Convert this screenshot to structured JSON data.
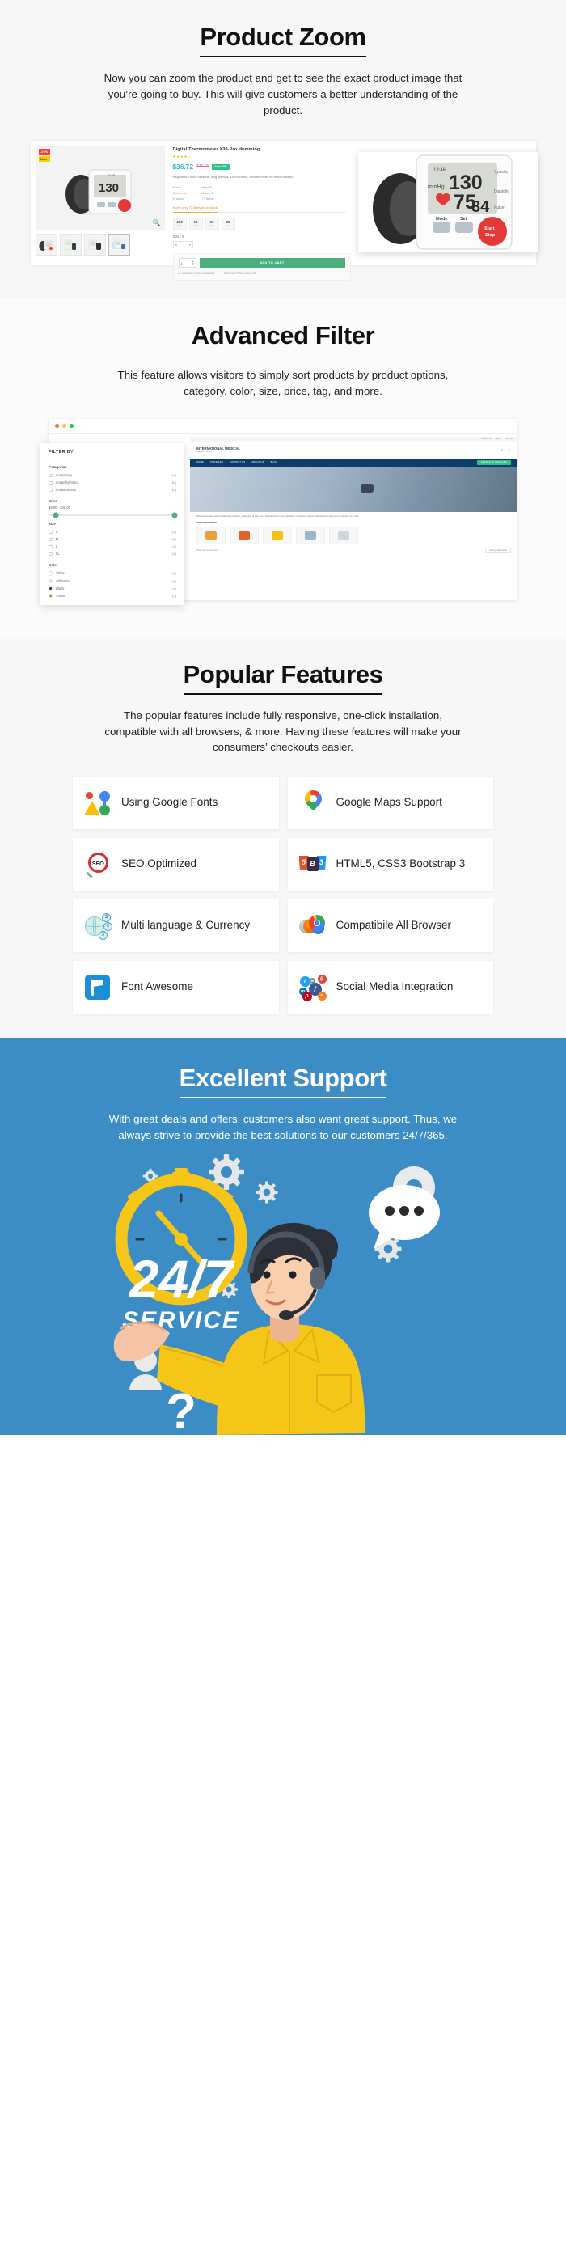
{
  "sections": {
    "product_zoom": {
      "title": "Product Zoom",
      "subtitle": "Now you can zoom the product and get to see the exact product image that you’re going to buy. This will give customers a better understanding of the product.",
      "screenshot": {
        "badges": [
          "-20%",
          "New"
        ],
        "product_name": "Digital Thermometer X30-Pro Humming",
        "stars": "★★★★☆",
        "price": "$36.72",
        "old_price": "$46.00",
        "save_badge": "Save 20%",
        "description": "Regular fit, round neckline, long sleeves. 100% cotton, brushed inner for extra comfort.",
        "attributes": [
          {
            "key": "Brand",
            "value": ": brand3"
          },
          {
            "key": "Reference",
            "value": ": demo_3"
          },
          {
            "key": "In stock",
            "value": ": 77 Items"
          }
        ],
        "hurry_text": "Hurry! only 77 items left in stock.",
        "countdown": [
          {
            "value": "408",
            "unit": "Days"
          },
          {
            "value": "12",
            "unit": "HRS"
          },
          {
            "value": "56",
            "unit": "MINs"
          },
          {
            "value": "28",
            "unit": "Secs"
          }
        ],
        "size_label": "Size : S",
        "size_value": "S",
        "quantity": "1",
        "add_to_cart": "ADD TO CART",
        "remove_compare": "REMOVE FROM COMPARE",
        "remove_wishlist": "REMOVE FROM WISHLIST",
        "zoom_icon": "magnifier-icon"
      }
    },
    "advanced_filter": {
      "title": "Advanced Filter",
      "subtitle": "This feature allows visitors to simply sort products by product options, category, color, size, price, tag, and more.",
      "browser": {
        "store_name": "INTERNATIONAL MEDICAL",
        "store_tagline": "Healthcare store",
        "top_links": [
          "Contact us",
          "Sign in",
          "Cart (0)"
        ],
        "nav_items": [
          "HOME",
          "STANDARD",
          "CONTACT US",
          "ABOUT US",
          "BLOG"
        ],
        "search_label": "SEARCH IN MEDICINE",
        "hero_caption": "Discover our best-selling healthcare products, a selection of care items for everyday in your operations. Compare to prices with with personality and it matches your care.",
        "subcategories_label": "SUBCATEGORIES",
        "products_label": "There are 11 products.",
        "sort_label": "Sort by:",
        "sort_value": "Relevance"
      },
      "filter_panel": {
        "heading": "FILTER BY",
        "groups": [
          {
            "name": "Categories",
            "type": "checkbox",
            "options": [
              {
                "label": "Antianxiety",
                "count": "(11)"
              },
              {
                "label": "Antiarrhythmics",
                "count": "(10)"
              },
              {
                "label": "Antibacterials",
                "count": "(10)"
              }
            ]
          },
          {
            "name": "Price",
            "type": "range",
            "value": "$9.00 - $46.00"
          },
          {
            "name": "Size",
            "type": "checkbox",
            "options": [
              {
                "label": "S",
                "count": "(4)"
              },
              {
                "label": "M",
                "count": "(5)"
              },
              {
                "label": "L",
                "count": "(3)"
              },
              {
                "label": "XL",
                "count": "(2)"
              }
            ]
          },
          {
            "name": "Color",
            "type": "swatch",
            "options": [
              {
                "label": "White",
                "count": "(4)",
                "color": "#ffffff"
              },
              {
                "label": "Off White",
                "count": "(1)",
                "color": "#f6ddc0"
              },
              {
                "label": "Black",
                "count": "(4)",
                "color": "#263238"
              },
              {
                "label": "Camel",
                "count": "(3)",
                "color": "#c8863c"
              }
            ]
          }
        ]
      }
    },
    "popular_features": {
      "title": "Popular Features",
      "subtitle": "The popular features include  fully responsive, one-click installation, compatible with all browsers, & more. Having these features will make your consumers’ checkouts easier.",
      "cards": [
        {
          "label": "Using Google Fonts",
          "icon": "google-fonts-icon"
        },
        {
          "label": "Google Maps Support",
          "icon": "google-maps-icon"
        },
        {
          "label": "SEO Optimized",
          "icon": "seo-magnifier-icon"
        },
        {
          "label": "HTML5, CSS3 Bootstrap 3",
          "icon": "html5-css3-bootstrap-icon"
        },
        {
          "label": "Multi language & Currency",
          "icon": "globe-currency-icon"
        },
        {
          "label": "Compatibile All Browser",
          "icon": "browsers-icon"
        },
        {
          "label": "Font Awesome",
          "icon": "font-awesome-flag-icon"
        },
        {
          "label": "Social Media Integration",
          "icon": "social-media-icon"
        }
      ]
    },
    "excellent_support": {
      "title": "Excellent Support",
      "subtitle": "With great deals and offers, customers also want great support. Thus, we always strive to provide the best solutions to our customers 24/7/365.",
      "illustration": {
        "headline": "24/7",
        "subhead": "SERVICE",
        "icons": [
          "gear-icon",
          "stopwatch-icon",
          "chat-bubble-icon",
          "location-pin-icon",
          "user-icon",
          "question-mark-icon"
        ]
      }
    }
  },
  "colors": {
    "page_bg": "#f7f7f7",
    "support_bg": "#3c8dc5",
    "accent_green": "#4caf7d",
    "price_blue": "#29b6d8",
    "yellow": "#f5c518"
  }
}
